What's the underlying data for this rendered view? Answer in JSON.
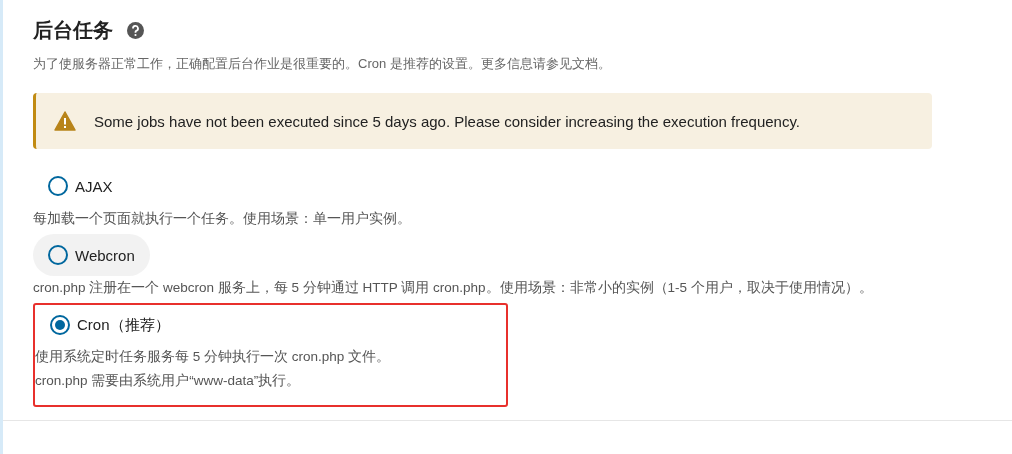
{
  "section": {
    "title": "后台任务",
    "description": "为了使服务器正常工作，正确配置后台作业是很重要的。Cron 是推荐的设置。更多信息请参见文档。"
  },
  "warning": {
    "text": "Some jobs have not been executed since 5 days ago. Please consider increasing the execution frequency."
  },
  "options": [
    {
      "label": "AJAX",
      "selected": false,
      "highlighted": false,
      "annotated": false,
      "descriptions": [
        "每加载一个页面就执行一个任务。使用场景：单一用户实例。"
      ]
    },
    {
      "label": "Webcron",
      "selected": false,
      "highlighted": true,
      "annotated": false,
      "descriptions": [
        "cron.php 注册在一个 webcron 服务上，每 5 分钟通过 HTTP 调用 cron.php。使用场景：非常小的实例（1-5 个用户，取决于使用情况）。"
      ]
    },
    {
      "label": "Cron（推荐）",
      "selected": true,
      "highlighted": false,
      "annotated": true,
      "descriptions": [
        "使用系统定时任务服务每 5 分钟执行一次 cron.php 文件。",
        "cron.php 需要由系统用户“www-data”执行。"
      ]
    }
  ]
}
